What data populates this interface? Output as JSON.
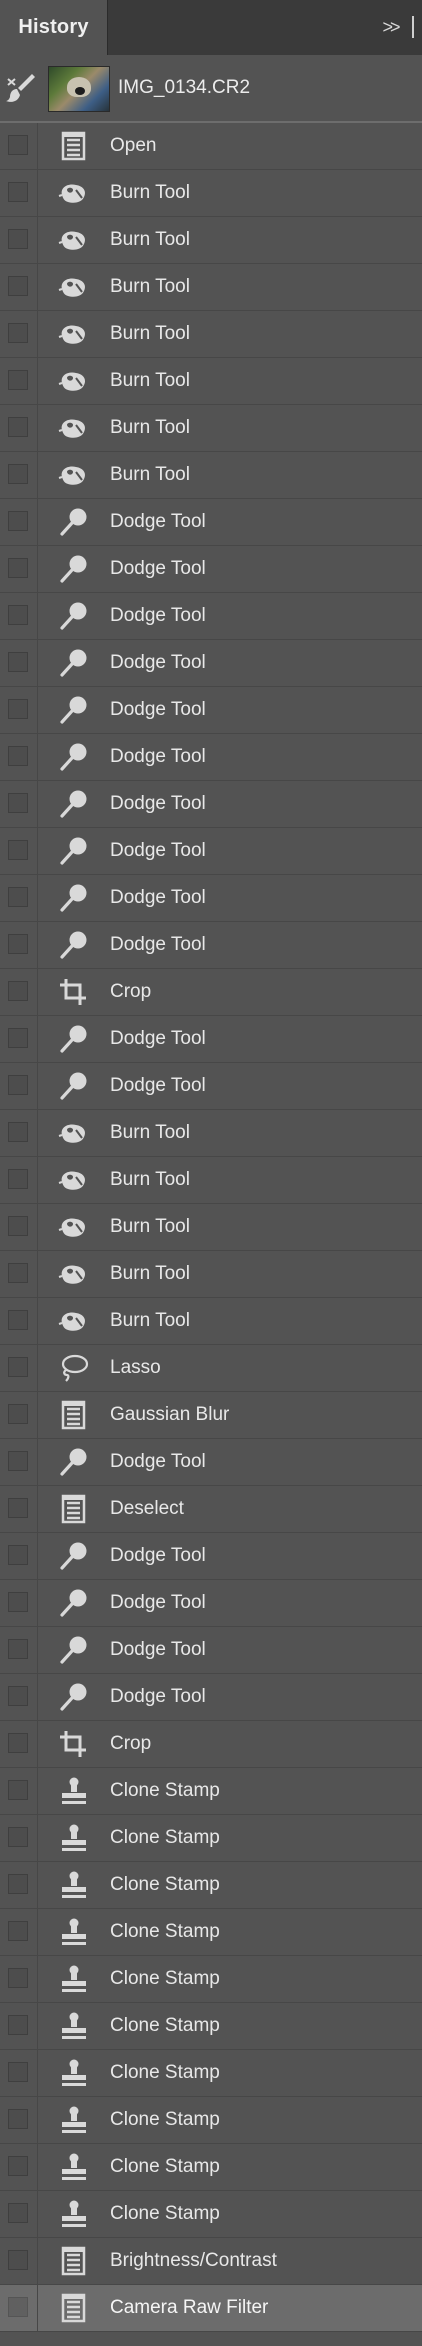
{
  "panel": {
    "tab_title": "History",
    "collapse_label": ">>"
  },
  "snapshot": {
    "name": "IMG_0134.CR2"
  },
  "states": [
    {
      "label": "Open",
      "icon": "document-icon"
    },
    {
      "label": "Burn Tool",
      "icon": "burn-tool-icon"
    },
    {
      "label": "Burn Tool",
      "icon": "burn-tool-icon"
    },
    {
      "label": "Burn Tool",
      "icon": "burn-tool-icon"
    },
    {
      "label": "Burn Tool",
      "icon": "burn-tool-icon"
    },
    {
      "label": "Burn Tool",
      "icon": "burn-tool-icon"
    },
    {
      "label": "Burn Tool",
      "icon": "burn-tool-icon"
    },
    {
      "label": "Burn Tool",
      "icon": "burn-tool-icon"
    },
    {
      "label": "Dodge Tool",
      "icon": "dodge-tool-icon"
    },
    {
      "label": "Dodge Tool",
      "icon": "dodge-tool-icon"
    },
    {
      "label": "Dodge Tool",
      "icon": "dodge-tool-icon"
    },
    {
      "label": "Dodge Tool",
      "icon": "dodge-tool-icon"
    },
    {
      "label": "Dodge Tool",
      "icon": "dodge-tool-icon"
    },
    {
      "label": "Dodge Tool",
      "icon": "dodge-tool-icon"
    },
    {
      "label": "Dodge Tool",
      "icon": "dodge-tool-icon"
    },
    {
      "label": "Dodge Tool",
      "icon": "dodge-tool-icon"
    },
    {
      "label": "Dodge Tool",
      "icon": "dodge-tool-icon"
    },
    {
      "label": "Dodge Tool",
      "icon": "dodge-tool-icon"
    },
    {
      "label": "Crop",
      "icon": "crop-icon"
    },
    {
      "label": "Dodge Tool",
      "icon": "dodge-tool-icon"
    },
    {
      "label": "Dodge Tool",
      "icon": "dodge-tool-icon"
    },
    {
      "label": "Burn Tool",
      "icon": "burn-tool-icon"
    },
    {
      "label": "Burn Tool",
      "icon": "burn-tool-icon"
    },
    {
      "label": "Burn Tool",
      "icon": "burn-tool-icon"
    },
    {
      "label": "Burn Tool",
      "icon": "burn-tool-icon"
    },
    {
      "label": "Burn Tool",
      "icon": "burn-tool-icon"
    },
    {
      "label": "Lasso",
      "icon": "lasso-icon"
    },
    {
      "label": "Gaussian Blur",
      "icon": "document-icon"
    },
    {
      "label": "Dodge Tool",
      "icon": "dodge-tool-icon"
    },
    {
      "label": "Deselect",
      "icon": "document-icon"
    },
    {
      "label": "Dodge Tool",
      "icon": "dodge-tool-icon"
    },
    {
      "label": "Dodge Tool",
      "icon": "dodge-tool-icon"
    },
    {
      "label": "Dodge Tool",
      "icon": "dodge-tool-icon"
    },
    {
      "label": "Dodge Tool",
      "icon": "dodge-tool-icon"
    },
    {
      "label": "Crop",
      "icon": "crop-icon"
    },
    {
      "label": "Clone Stamp",
      "icon": "clone-stamp-icon"
    },
    {
      "label": "Clone Stamp",
      "icon": "clone-stamp-icon"
    },
    {
      "label": "Clone Stamp",
      "icon": "clone-stamp-icon"
    },
    {
      "label": "Clone Stamp",
      "icon": "clone-stamp-icon"
    },
    {
      "label": "Clone Stamp",
      "icon": "clone-stamp-icon"
    },
    {
      "label": "Clone Stamp",
      "icon": "clone-stamp-icon"
    },
    {
      "label": "Clone Stamp",
      "icon": "clone-stamp-icon"
    },
    {
      "label": "Clone Stamp",
      "icon": "clone-stamp-icon"
    },
    {
      "label": "Clone Stamp",
      "icon": "clone-stamp-icon"
    },
    {
      "label": "Clone Stamp",
      "icon": "clone-stamp-icon"
    },
    {
      "label": "Brightness/Contrast",
      "icon": "document-icon"
    },
    {
      "label": "Camera Raw Filter",
      "icon": "document-icon",
      "current": true
    }
  ],
  "colors": {
    "panel_bg": "#535353",
    "tabbar_bg": "#3a3a3a",
    "current_row_bg": "#6c6c6c",
    "text": "#e8e8e8"
  }
}
